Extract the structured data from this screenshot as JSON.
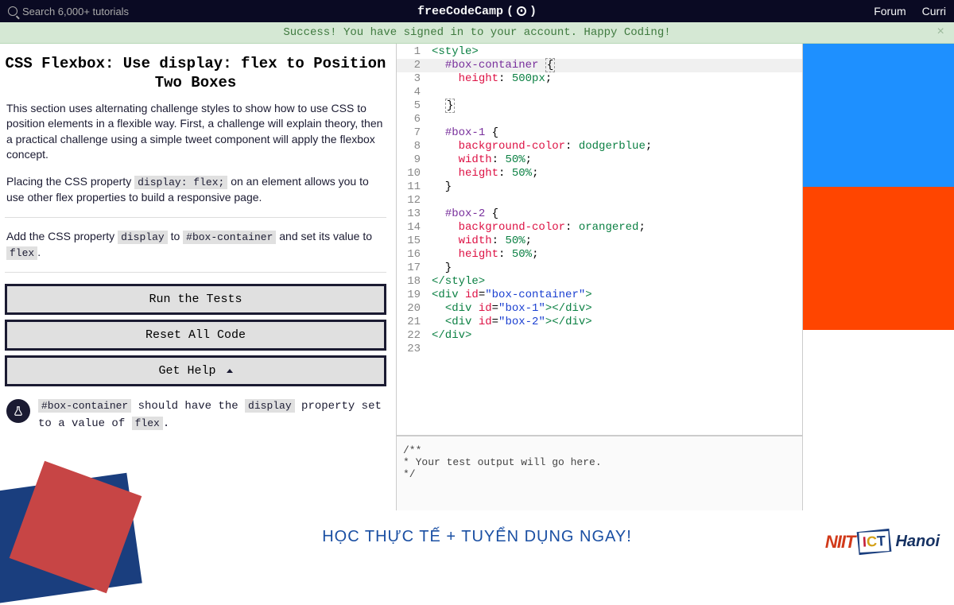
{
  "header": {
    "search_placeholder": "Search 6,000+ tutorials",
    "brand": "freeCodeCamp",
    "nav": {
      "forum": "Forum",
      "curriculum": "Curri"
    }
  },
  "banner": {
    "message": "Success! You have signed in to your account. Happy Coding!",
    "close": "×"
  },
  "challenge": {
    "title": "CSS Flexbox: Use display: flex to Position Two Boxes",
    "intro": "This section uses alternating challenge styles to show how to use CSS to position elements in a flexible way. First, a challenge will explain theory, then a practical challenge using a simple tweet component will apply the flexbox concept.",
    "para2_a": "Placing the CSS property ",
    "para2_code": "display: flex;",
    "para2_b": " on an element allows you to use other flex properties to build a responsive page.",
    "instr_a": "Add the CSS property ",
    "instr_code1": "display",
    "instr_b": " to ",
    "instr_code2": "#box-container",
    "instr_c": " and set its value to ",
    "instr_code3": "flex",
    "instr_d": ".",
    "btn_run": "Run the Tests",
    "btn_reset": "Reset All Code",
    "btn_help": "Get Help",
    "test_code1": "#box-container",
    "test_a": " should have the ",
    "test_code2": "display",
    "test_b": " property set to a value of ",
    "test_code3": "flex",
    "test_c": "."
  },
  "output": {
    "line1": "/**",
    "line2": "* Your test output will go here.",
    "line3": "*/"
  },
  "footer": {
    "slogan": "HỌC THỰC TẾ + TUYỂN DỤNG NGAY!",
    "niit": "NIIT",
    "hanoi": "Hanoi"
  },
  "code": {
    "lines": 23
  }
}
